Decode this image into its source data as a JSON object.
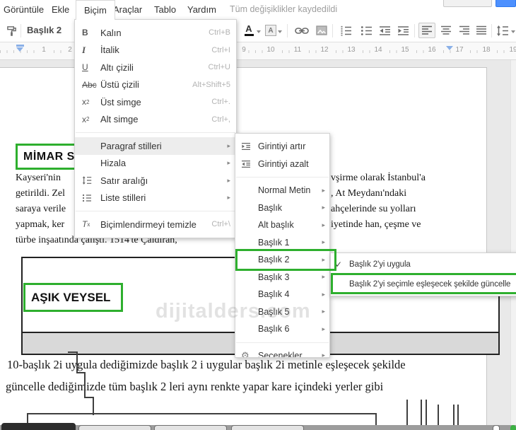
{
  "menubar": {
    "items": [
      "Görüntüle",
      "Ekle",
      "Biçim",
      "Araçlar",
      "Tablo",
      "Yardım"
    ],
    "status_text": "Tüm değişiklikler kaydedildi"
  },
  "toolbar": {
    "style_value": "Başlık 2"
  },
  "ruler": {
    "numbers": [
      "1",
      "2",
      "9",
      "10",
      "11",
      "12",
      "13",
      "14",
      "15",
      "16",
      "17",
      "18",
      "19"
    ]
  },
  "format_menu": {
    "items": [
      {
        "label": "Kalın",
        "shortcut": "Ctrl+B"
      },
      {
        "label": "İtalik",
        "shortcut": "Ctrl+I"
      },
      {
        "label": "Altı çizili",
        "shortcut": "Ctrl+U"
      },
      {
        "label": "Üstü çizili",
        "shortcut": "Alt+Shift+5"
      },
      {
        "label": "Üst simge",
        "shortcut": "Ctrl+."
      },
      {
        "label": "Alt simge",
        "shortcut": "Ctrl+,"
      },
      {
        "label": "Paragraf stilleri",
        "shortcut": ""
      },
      {
        "label": "Hizala",
        "shortcut": ""
      },
      {
        "label": "Satır aralığı",
        "shortcut": ""
      },
      {
        "label": "Liste stilleri",
        "shortcut": ""
      },
      {
        "label": "Biçimlendirmeyi temizle",
        "shortcut": "Ctrl+\\"
      }
    ]
  },
  "paragraph_styles_menu": {
    "items": [
      "Girintiyi artır",
      "Girintiyi azalt",
      "Normal Metin",
      "Başlık",
      "Alt başlık",
      "Başlık 1",
      "Başlık 2",
      "Başlık 3",
      "Başlık 4",
      "Başlık 5",
      "Başlık 6",
      "Seçenekler"
    ]
  },
  "heading2_submenu": {
    "apply_label": "Başlık 2'yi uygula",
    "update_label": "Başlık 2'yi seçimle eşleşecek şekilde güncelle"
  },
  "document": {
    "heading_mimar": "MİMAR S",
    "paragraph_lines": [
      {
        "left": "Kayseri'nin",
        "right": "vşirme olarak İstanbul'a"
      },
      {
        "left": "getirildi. Zel",
        "right": ", At Meydanı'ndaki"
      },
      {
        "left": "saraya verile",
        "right": "ahçelerinde su yolları"
      },
      {
        "left": "yapmak, ker",
        "right": "iyetinde han, çeşme ve"
      },
      {
        "left": "türbe inşaatında çalıştı. 1514'te Çaldıran,",
        "right": ""
      }
    ],
    "heading_asik": "AŞIK VEYSEL",
    "bottom_lines": [
      "10-başlık 2i uygula dediğimizde başlık 2 i uygular başlık 2i metinle  eşleşecek şekilde",
      "güncelle dediğimizde tüm başlık 2 leri aynı renkte yapar kare içindeki yerler gibi"
    ]
  },
  "watermark": "dijitalders.com",
  "icons": {
    "bold": "B",
    "italic": "I",
    "underline": "U",
    "strikethrough": "Abc",
    "sup_base": "x",
    "sup_exp": "2",
    "sub_base": "x",
    "sub_idx": "2",
    "clear_t": "T",
    "clear_x": "x",
    "gear": "⚙",
    "check": "✓",
    "arrow": "▸",
    "text_color_letter": "A",
    "highlight_letter": "A"
  },
  "colors": {
    "box_green": "#2eaf2e",
    "share_blue": "#4d90fe",
    "marker_blue": "#8ab0e8"
  }
}
